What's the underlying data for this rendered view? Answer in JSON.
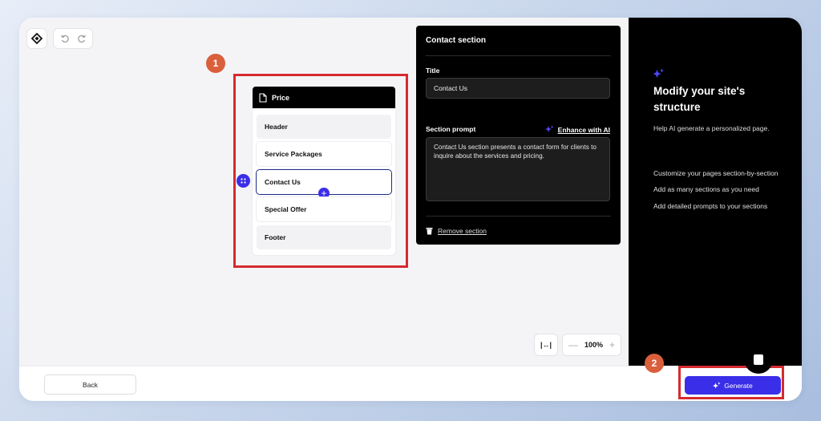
{
  "page_card": {
    "title": "Price",
    "sections": [
      {
        "label": "Header"
      },
      {
        "label": "Service Packages"
      },
      {
        "label": "Contact Us"
      },
      {
        "label": "Special Offer"
      },
      {
        "label": "Footer"
      }
    ]
  },
  "editor": {
    "heading": "Contact section",
    "title_label": "Title",
    "title_value": "Contact Us",
    "prompt_label": "Section prompt",
    "enhance_label": "Enhance with AI",
    "prompt_value": "Contact Us section presents a contact form for clients to inquire about the services and pricing.",
    "remove_label": "Remove section"
  },
  "zoom": {
    "fit_label": "|↔|",
    "minus": "—",
    "level": "100%",
    "plus": "+"
  },
  "side_panel": {
    "title": "Modify your site's structure",
    "subtitle": "Help AI generate a personalized page.",
    "tips": [
      "Customize your pages section-by-section",
      "Add as many sections as you need",
      "Add detailed prompts to your sections"
    ]
  },
  "footer": {
    "back_label": "Back",
    "generate_label": "Generate"
  },
  "annotations": {
    "step1": "1",
    "step2": "2"
  },
  "icons": {
    "logo": "diamond-logo-icon",
    "undo": "undo-icon",
    "redo": "redo-icon",
    "page": "document-icon",
    "drag": "drag-handle-icon",
    "add": "plus-icon",
    "sparkle": "sparkle-icon",
    "trash": "trash-icon",
    "chat": "chat-icon"
  },
  "colors": {
    "accent": "#3b2ee8",
    "highlight": "#d52a2f",
    "badge": "#d95f3d",
    "panel": "#000000"
  }
}
